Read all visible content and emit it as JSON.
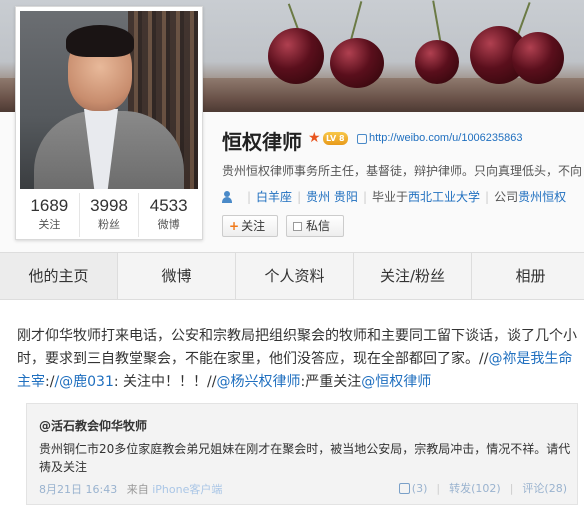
{
  "profile": {
    "name": "恒权律师",
    "level": "LV 8",
    "url": "http://weibo.com/u/1006235863",
    "description": "贵州恒权律师事务所主任，基督徒，辩护律师。只向真理低头，不向",
    "info": {
      "constellation": "白羊座",
      "location": "贵州 贵阳",
      "school_prefix": "毕业于",
      "school": "西北工业大学",
      "company_prefix": "公司",
      "company": "贵州恒权"
    },
    "stats": [
      {
        "value": "1689",
        "label": "关注"
      },
      {
        "value": "3998",
        "label": "粉丝"
      },
      {
        "value": "4533",
        "label": "微博"
      }
    ],
    "follow_label": "关注",
    "message_label": "私信"
  },
  "nav": {
    "tabs": [
      "他的主页",
      "微博",
      "个人资料",
      "关注/粉丝",
      "相册"
    ]
  },
  "post": {
    "text_1": "刚才仰华牧师打来电话，公安和宗教局把组织聚会的牧师和主要同工留下谈话，谈了几个小时，要求到三自教堂聚会，不能在家里，他们没答应，现在全部都回了家。//",
    "mention_1": "@祢是我生命主宰",
    "text_2": ":/",
    "mention_2": "/@鹿031",
    "text_3": ": 关注中！！！//",
    "mention_3": "@杨兴权律师",
    "text_4": ":严重关注",
    "mention_4": "@恒权律师",
    "quote": {
      "author": "@活石教会仰华牧师",
      "text": "贵州铜仁市20多位家庭教会弟兄姐妹在刚才在聚会时，被当地公安局，宗教局冲击，情况不祥。请代祷及关注",
      "date": "8月21日 16:43",
      "source_prefix": "来自",
      "source": "iPhone客户端",
      "likes": "(3)",
      "reposts": "转发(102)",
      "comments": "评论(28)"
    }
  }
}
